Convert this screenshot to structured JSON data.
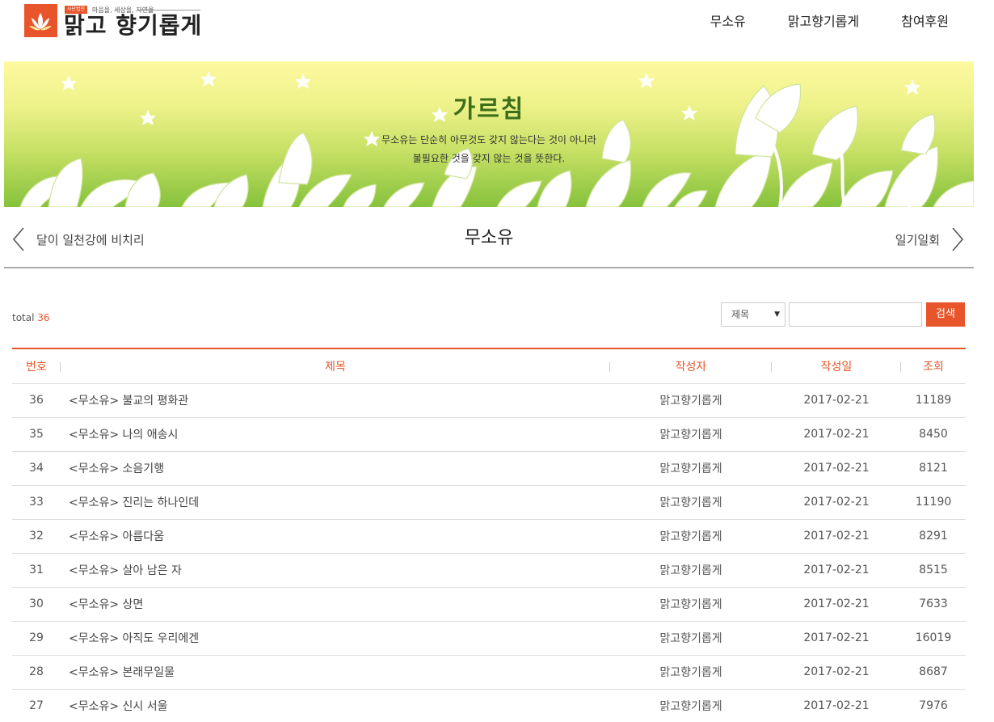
{
  "header": {
    "logo_badge": "사단법인",
    "logo_tagline": "마음을, 세상을, 자연을",
    "logo_text": "맑고 향기롭게",
    "nav": [
      "무소유",
      "맑고향기롭게",
      "참여후원"
    ]
  },
  "banner": {
    "title": "가르침",
    "subtitle_line1": "무소유는 단순히 아무것도 갖지 않는다는 것이 아니라",
    "subtitle_line2": "불필요한 것을 갖지 않는 것을 뜻한다."
  },
  "pager": {
    "prev_label": "달이 일천강에 비치리",
    "current": "무소유",
    "next_label": "일기일회"
  },
  "board": {
    "total_label": "total",
    "total_count": "36",
    "search_field": "제목",
    "search_value": "",
    "search_button": "검색",
    "columns": [
      "번호",
      "제목",
      "작성자",
      "작성일",
      "조회"
    ],
    "rows": [
      {
        "no": "36",
        "title": "<무소유> 불교의 평화관",
        "author": "맑고향기롭게",
        "date": "2017-02-21",
        "views": "11189"
      },
      {
        "no": "35",
        "title": "<무소유> 나의 애송시",
        "author": "맑고향기롭게",
        "date": "2017-02-21",
        "views": "8450"
      },
      {
        "no": "34",
        "title": "<무소유> 소음기행",
        "author": "맑고향기롭게",
        "date": "2017-02-21",
        "views": "8121"
      },
      {
        "no": "33",
        "title": "<무소유> 진리는 하나인데",
        "author": "맑고향기롭게",
        "date": "2017-02-21",
        "views": "11190"
      },
      {
        "no": "32",
        "title": "<무소유> 아름다움",
        "author": "맑고향기롭게",
        "date": "2017-02-21",
        "views": "8291"
      },
      {
        "no": "31",
        "title": "<무소유> 살아 남은 자",
        "author": "맑고향기롭게",
        "date": "2017-02-21",
        "views": "8515"
      },
      {
        "no": "30",
        "title": "<무소유> 상면",
        "author": "맑고향기롭게",
        "date": "2017-02-21",
        "views": "7633"
      },
      {
        "no": "29",
        "title": "<무소유> 아직도 우리에겐",
        "author": "맑고향기롭게",
        "date": "2017-02-21",
        "views": "16019"
      },
      {
        "no": "28",
        "title": "<무소유> 본래무일물",
        "author": "맑고향기롭게",
        "date": "2017-02-21",
        "views": "8687"
      },
      {
        "no": "27",
        "title": "<무소유> 신시 서울",
        "author": "맑고향기롭게",
        "date": "2017-02-21",
        "views": "7976"
      }
    ]
  },
  "colors": {
    "accent": "#e8552a",
    "banner_title": "#3d6e1a"
  },
  "icons": [
    "lotus-logo-icon",
    "chevron-left-icon",
    "chevron-right-icon",
    "dropdown-arrow-icon",
    "star-icon",
    "lotus-flower-icon"
  ]
}
